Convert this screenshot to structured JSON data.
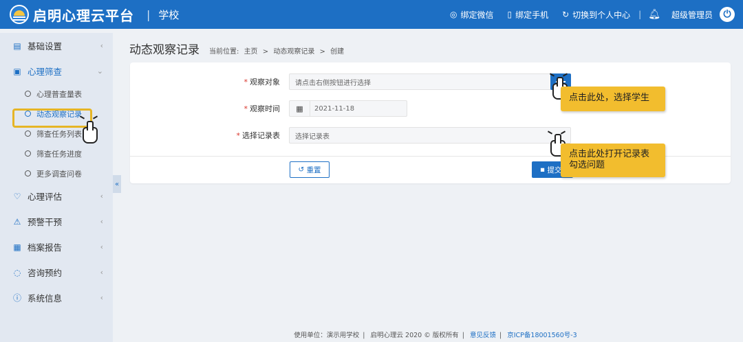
{
  "header": {
    "logo_text": "启明心理云平台",
    "separator": "|",
    "school": "学校",
    "links": [
      {
        "icon": "wechat-icon",
        "label": "绑定微信"
      },
      {
        "icon": "phone-icon",
        "label": "绑定手机"
      },
      {
        "icon": "switch-icon",
        "label": "切换到个人中心"
      }
    ],
    "user": "超级管理员"
  },
  "sidebar": {
    "items": [
      {
        "label": "基础设置"
      },
      {
        "label": "心理筛查"
      },
      {
        "label": "心理评估"
      },
      {
        "label": "预警干预"
      },
      {
        "label": "档案报告"
      },
      {
        "label": "咨询预约"
      },
      {
        "label": "系统信息"
      }
    ],
    "subitems": [
      {
        "label": "心理普查量表"
      },
      {
        "label": "动态观察记录"
      },
      {
        "label": "筛查任务列表"
      },
      {
        "label": "筛查任务进度"
      },
      {
        "label": "更多调查问卷"
      }
    ],
    "collapse": "«"
  },
  "page": {
    "title": "动态观察记录",
    "breadcrumb": {
      "prefix": "当前位置:",
      "home": "主页",
      "sep": ">",
      "section": "动态观察记录",
      "current": "创建"
    }
  },
  "form": {
    "target": {
      "label": "观察对象",
      "placeholder": "请点击右侧按钮进行选择"
    },
    "time": {
      "label": "观察时间",
      "value": "2021-11-18"
    },
    "record": {
      "label": "选择记录表",
      "placeholder": "选择记录表"
    },
    "reset_label": "重置",
    "submit_label": "提交"
  },
  "callouts": {
    "first": "点击此处，选择学生",
    "second_line1": "点击此处打开记录表",
    "second_line2": "勾选问题"
  },
  "footer": {
    "unit": "使用单位：演示用学校",
    "copyright": "启明心理云 2020 © 版权所有",
    "feedback": "意见反馈",
    "icp": "京ICP备18001560号-3"
  }
}
